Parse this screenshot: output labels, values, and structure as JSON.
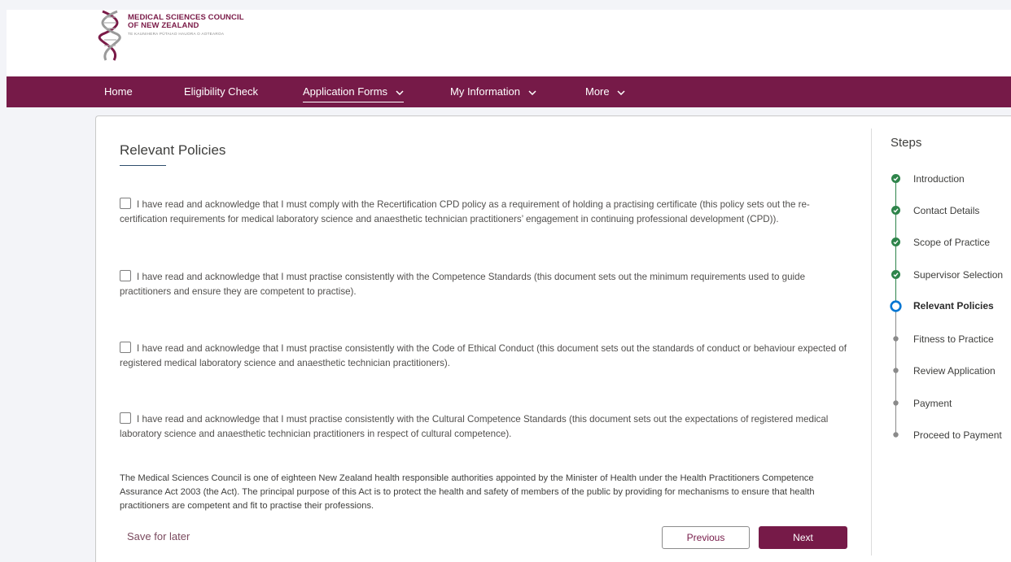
{
  "logo": {
    "line1": "MEDICAL SCIENCES COUNCIL",
    "line2": "OF NEW ZEALAND",
    "line3": "TE KAUNIHERA PŪTAIAO HAUORA O AOTEAROA"
  },
  "nav": {
    "items": [
      {
        "label": "Home",
        "has_dropdown": false
      },
      {
        "label": "Eligibility Check",
        "has_dropdown": false
      },
      {
        "label": "Application Forms",
        "has_dropdown": true,
        "active": true
      },
      {
        "label": "My Information",
        "has_dropdown": true
      },
      {
        "label": "More",
        "has_dropdown": true
      }
    ]
  },
  "main": {
    "title": "Relevant Policies",
    "policies": [
      {
        "text": "I have read and acknowledge that I must comply with the Recertification CPD policy as a requirement of holding a practising certificate (this policy sets out the re-certification requirements for medical laboratory science and anaesthetic technician practitioners’ engagement in continuing professional development (CPD)).",
        "checked": false
      },
      {
        "text": "I have read and acknowledge that I must practise consistently with the Competence Standards (this document sets out the minimum requirements used to guide practitioners and ensure they are competent to practise).",
        "checked": false
      },
      {
        "text": "I have read and acknowledge that I must practise consistently with the Code of Ethical Conduct (this document sets out the standards of conduct or behaviour expected of registered medical laboratory science and anaesthetic technician practitioners).",
        "checked": false
      },
      {
        "text": "I have read and acknowledge that I must practise consistently with the Cultural Competence Standards (this document sets out the expectations of registered medical laboratory science and anaesthetic technician practitioners in respect of cultural competence).",
        "checked": false
      }
    ],
    "info": "The Medical Sciences Council is one of eighteen New Zealand health responsible authorities appointed by the Minister of Health under the Health Practitioners Competence Assurance Act 2003 (the Act). The principal purpose of this Act is to protect the health and safety of members of the public by providing for mechanisms to ensure that health practitioners are competent and fit to practise their professions.",
    "save_later": "Save for later",
    "previous": "Previous",
    "next": "Next"
  },
  "steps": {
    "title": "Steps",
    "items": [
      {
        "label": "Introduction",
        "status": "complete"
      },
      {
        "label": "Contact Details",
        "status": "complete"
      },
      {
        "label": "Scope of Practice",
        "status": "complete"
      },
      {
        "label": "Supervisor Selection",
        "status": "complete"
      },
      {
        "label": "Relevant Policies",
        "status": "current"
      },
      {
        "label": "Fitness to Practice",
        "status": "pending"
      },
      {
        "label": "Review Application",
        "status": "pending"
      },
      {
        "label": "Payment",
        "status": "pending"
      },
      {
        "label": "Proceed to Payment",
        "status": "pending"
      }
    ]
  },
  "colors": {
    "brand": "#761a48",
    "complete": "#2e844a",
    "current": "#0176d3",
    "pending": "#8a8a8a"
  }
}
